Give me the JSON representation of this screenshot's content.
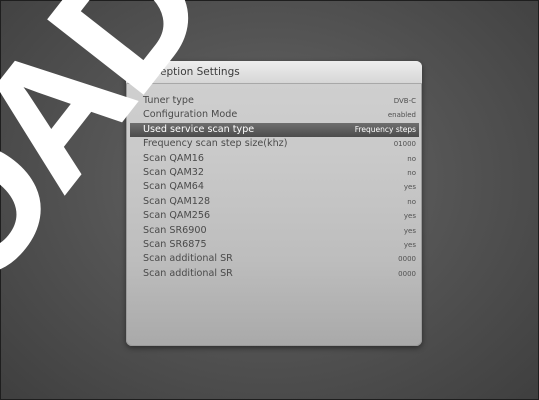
{
  "panel": {
    "title": "Reception Settings",
    "rows": [
      {
        "label": "Tuner type",
        "value": "DVB-C"
      },
      {
        "label": "Configuration Mode",
        "value": "enabled"
      },
      {
        "label": "Used service scan type",
        "value": "Frequency steps"
      },
      {
        "label": "Frequency scan step size(khz)",
        "value": "01000"
      },
      {
        "label": "Scan QAM16",
        "value": "no"
      },
      {
        "label": "Scan QAM32",
        "value": "no"
      },
      {
        "label": "Scan QAM64",
        "value": "yes"
      },
      {
        "label": "Scan QAM128",
        "value": "no"
      },
      {
        "label": "Scan QAM256",
        "value": "yes"
      },
      {
        "label": "Scan SR6900",
        "value": "yes"
      },
      {
        "label": "Scan SR6875",
        "value": "yes"
      },
      {
        "label": "Scan additional SR",
        "value": "0000"
      },
      {
        "label": "Scan additional SR",
        "value": "0000"
      }
    ],
    "selected_index": 2
  },
  "watermark": {
    "text": "OAD"
  },
  "colors": {
    "panel": "#c9c9c9",
    "selection": "#5a5a5a",
    "background": "#555555"
  }
}
